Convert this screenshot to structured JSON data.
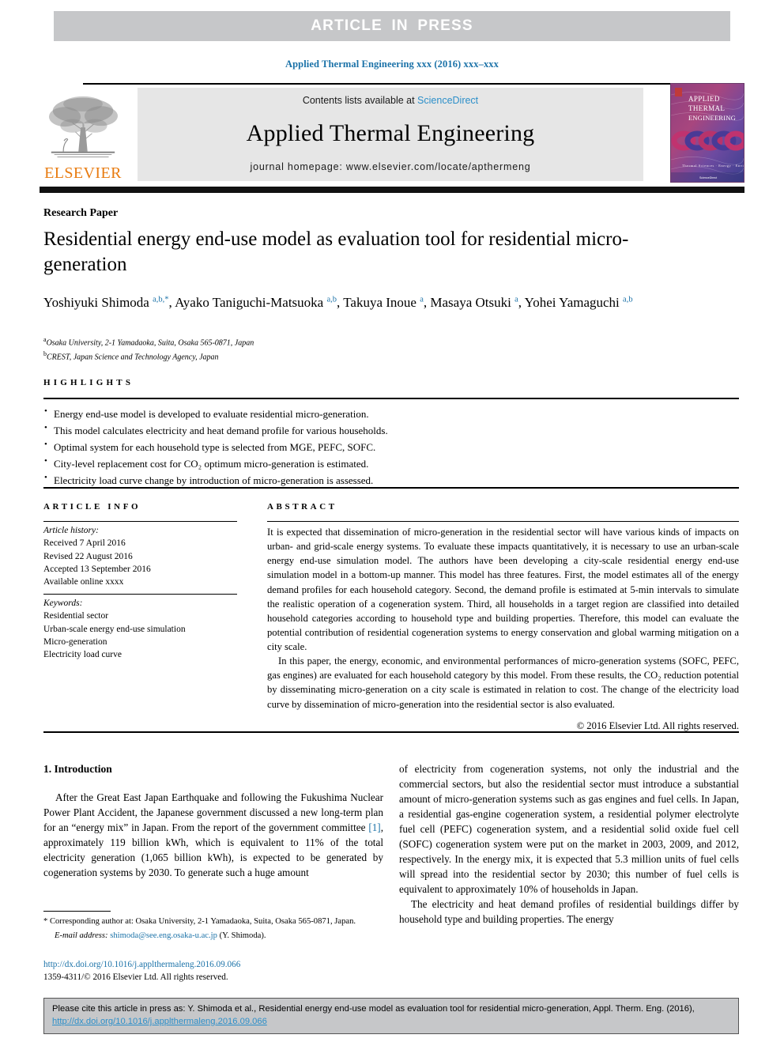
{
  "banner": {
    "article_in_press": "ARTICLE  IN  PRESS"
  },
  "running_head": "Applied Thermal Engineering xxx (2016) xxx–xxx",
  "masthead": {
    "contents_prefix": "Contents lists available at ",
    "sciencedirect": "ScienceDirect",
    "journal_name": "Applied Thermal Engineering",
    "homepage": "journal homepage: www.elsevier.com/locate/apthermeng",
    "publisher": "ELSEVIER",
    "cover_lines": [
      "APPLIED",
      "THERMAL",
      "ENGINEERING"
    ],
    "cover_footer": "Thermal Sciences, Energy, Environment"
  },
  "article": {
    "type_label": "Research Paper",
    "title": "Residential energy end-use model as evaluation tool for residential micro-generation",
    "authors_html": "Yoshiyuki Shimoda <sup>a,b,*</sup>, Ayako Taniguchi-Matsuoka <sup>a,b</sup>, Takuya Inoue <sup>a</sup>, Masaya Otsuki <sup>a</sup>, Yohei Yamaguchi <sup>a,b</sup>",
    "affiliations": [
      {
        "marker": "a",
        "text": "Osaka University, 2-1 Yamadaoka, Suita, Osaka 565-0871, Japan"
      },
      {
        "marker": "b",
        "text": "CREST, Japan Science and Technology Agency, Japan"
      }
    ]
  },
  "highlights": {
    "heading": "HIGHLIGHTS",
    "items": [
      "Energy end-use model is developed to evaluate residential micro-generation.",
      "This model calculates electricity and heat demand profile for various households.",
      "Optimal system for each household type is selected from MGE, PEFC, SOFC.",
      "City-level replacement cost for CO₂ optimum micro-generation is estimated.",
      "Electricity load curve change by introduction of micro-generation is assessed."
    ]
  },
  "article_info": {
    "heading": "ARTICLE INFO",
    "history_heading": "Article history:",
    "history": [
      "Received 7 April 2016",
      "Revised 22 August 2016",
      "Accepted 13 September 2016",
      "Available online xxxx"
    ],
    "keywords_heading": "Keywords:",
    "keywords": [
      "Residential sector",
      "Urban-scale energy end-use simulation",
      "Micro-generation",
      "Electricity load curve"
    ]
  },
  "abstract": {
    "heading": "ABSTRACT",
    "paragraph1": "It is expected that dissemination of micro-generation in the residential sector will have various kinds of impacts on urban- and grid-scale energy systems. To evaluate these impacts quantitatively, it is necessary to use an urban-scale energy end-use simulation model. The authors have been developing a city-scale residential energy end-use simulation model in a bottom-up manner. This model has three features. First, the model estimates all of the energy demand profiles for each household category. Second, the demand profile is estimated at 5-min intervals to simulate the realistic operation of a cogeneration system. Third, all households in a target region are classified into detailed household categories according to household type and building properties. Therefore, this model can evaluate the potential contribution of residential cogeneration systems to energy conservation and global warming mitigation on a city scale.",
    "paragraph2": "In this paper, the energy, economic, and environmental performances of micro-generation systems (SOFC, PEFC, gas engines) are evaluated for each household category by this model. From these results, the CO₂ reduction potential by disseminating micro-generation on a city scale is estimated in relation to cost. The change of the electricity load curve by dissemination of micro-generation into the residential sector is also evaluated.",
    "copyright": "© 2016 Elsevier Ltd. All rights reserved."
  },
  "body": {
    "section_title": "1. Introduction",
    "left_paragraph_pre_ref": "After the Great East Japan Earthquake and following the Fukushima Nuclear Power Plant Accident, the Japanese government discussed a new long-term plan for an “energy mix” in Japan. From the report of the government committee ",
    "left_reference": "[1]",
    "left_paragraph_post_ref": ", approximately 119 billion kWh, which is equivalent to 11% of the total electricity generation (1,065 billion kWh), is expected to be generated by cogeneration systems by 2030. To generate such a huge amount",
    "right_paragraph1": "of electricity from cogeneration systems, not only the industrial and the commercial sectors, but also the residential sector must introduce a substantial amount of micro-generation systems such as gas engines and fuel cells. In Japan, a residential gas-engine cogeneration system, a residential polymer electrolyte fuel cell (PEFC) cogeneration system, and a residential solid oxide fuel cell (SOFC) cogeneration system were put on the market in 2003, 2009, and 2012, respectively. In the energy mix, it is expected that 5.3 million units of fuel cells will spread into the residential sector by 2030; this number of fuel cells is equivalent to approximately 10% of households in Japan.",
    "right_paragraph2": "The electricity and heat demand profiles of residential buildings differ by household type and building properties. The energy"
  },
  "footnote": {
    "corresponding": "* Corresponding author at: Osaka University, 2-1 Yamadaoka, Suita, Osaka 565-0871, Japan.",
    "email_label": "E-mail address:",
    "email": "shimoda@see.eng.osaka-u.ac.jp",
    "email_suffix": "(Y. Shimoda).",
    "doi_url": "http://dx.doi.org/10.1016/j.applthermaleng.2016.09.066",
    "issn_line": "1359-4311/© 2016 Elsevier Ltd. All rights reserved."
  },
  "cite_footer": {
    "text_before_link": "Please cite this article in press as: Y. Shimoda et al., Residential energy end-use model as evaluation tool for residential micro-generation, Appl. Therm. Eng. (2016), ",
    "link": "http://dx.doi.org/10.1016/j.applthermaleng.2016.09.066"
  },
  "colors": {
    "link_blue": "#1b72a8",
    "sciencedirect_blue": "#2c8fc9",
    "elsevier_orange": "#e87b10",
    "band_gray": "#c6c7c9",
    "masthead_gray": "#e6e6e6"
  }
}
